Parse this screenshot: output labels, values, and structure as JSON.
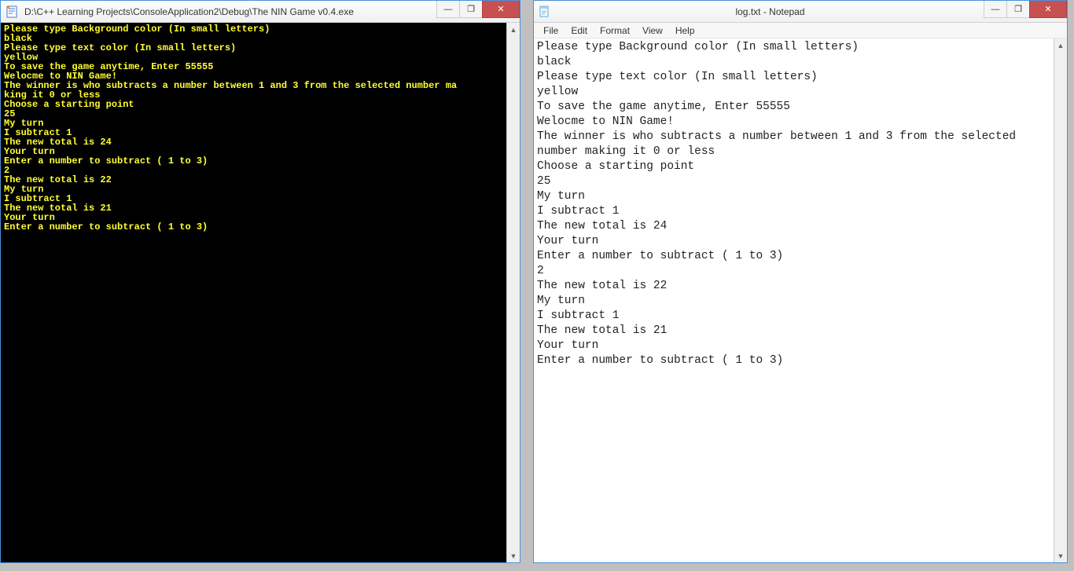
{
  "console": {
    "title": "D:\\C++ Learning Projects\\ConsoleApplication2\\Debug\\The NIN Game v0.4.exe",
    "lines": [
      "Please type Background color (In small letters)",
      "black",
      "Please type text color (In small letters)",
      "yellow",
      "To save the game anytime, Enter 55555",
      "Welocme to NIN Game!",
      "The winner is who subtracts a number between 1 and 3 from the selected number ma",
      "king it 0 or less",
      "Choose a starting point",
      "25",
      "My turn",
      "I subtract 1",
      "The new total is 24",
      "Your turn",
      "Enter a number to subtract ( 1 to 3)",
      "2",
      "The new total is 22",
      "My turn",
      "I subtract 1",
      "The new total is 21",
      "Your turn",
      "Enter a number to subtract ( 1 to 3)"
    ]
  },
  "notepad": {
    "title": "log.txt - Notepad",
    "menu": {
      "file": "File",
      "edit": "Edit",
      "format": "Format",
      "view": "View",
      "help": "Help"
    },
    "lines": [
      "Please type Background color (In small letters)",
      "black",
      "Please type text color (In small letters)",
      "yellow",
      "To save the game anytime, Enter 55555",
      "Welocme to NIN Game!",
      "The winner is who subtracts a number between 1 and 3 from the selected number making it 0 or less",
      "Choose a starting point",
      "25",
      "My turn",
      "I subtract 1",
      "The new total is 24",
      "Your turn",
      "Enter a number to subtract ( 1 to 3)",
      "2",
      "The new total is 22",
      "My turn",
      "I subtract 1",
      "The new total is 21",
      "Your turn",
      "Enter a number to subtract ( 1 to 3)"
    ]
  },
  "titlebar_buttons": {
    "minimize": "—",
    "maximize": "❐",
    "close": "✕"
  }
}
